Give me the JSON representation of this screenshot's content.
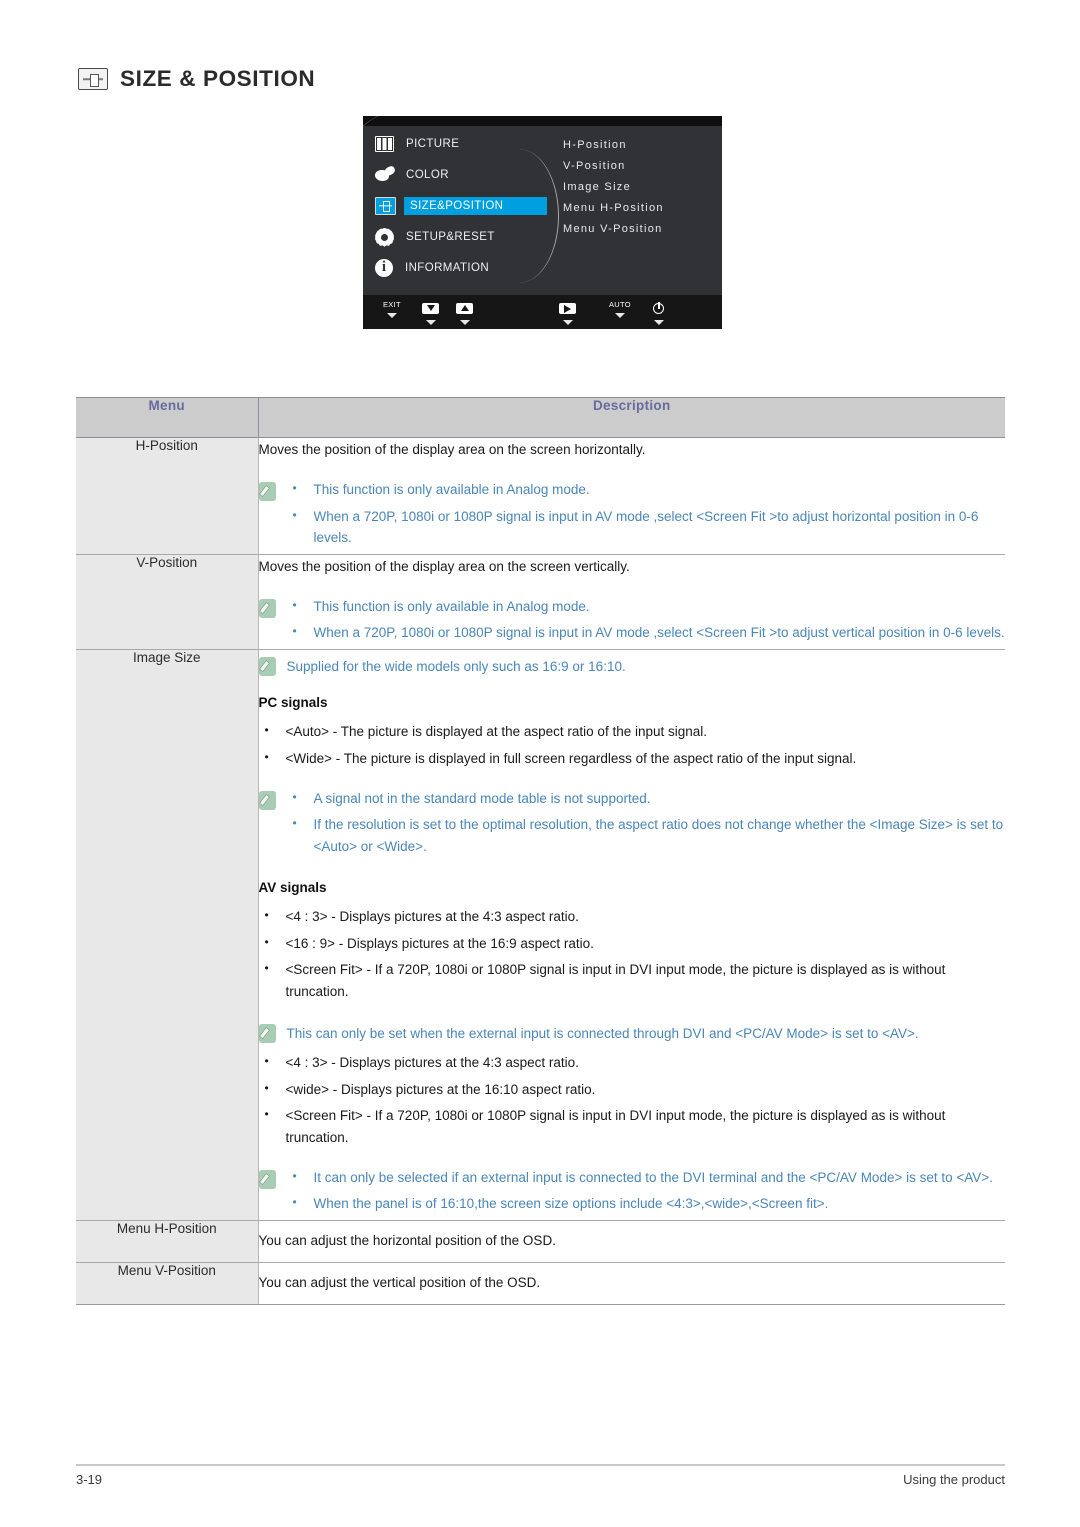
{
  "page": {
    "heading": "SIZE & POSITION",
    "heading_icon": "size-position-icon",
    "footer_page_number": "3-19",
    "footer_section": "Using the product"
  },
  "osd": {
    "menu_items": [
      {
        "label": "PICTURE",
        "icon": "picture-icon",
        "selected": false
      },
      {
        "label": "COLOR",
        "icon": "color-palette-icon",
        "selected": false
      },
      {
        "label": "SIZE&POSITION",
        "icon": "size-position-icon",
        "selected": true
      },
      {
        "label": "SETUP&RESET",
        "icon": "gear-icon",
        "selected": false
      },
      {
        "label": "INFORMATION",
        "icon": "info-icon",
        "selected": false
      }
    ],
    "submenu_items": [
      "H-Position",
      "V-Position",
      "Image Size",
      "Menu H-Position",
      "Menu V-Position"
    ],
    "buttons": [
      {
        "label": "EXIT",
        "icon": "exit-label"
      },
      {
        "label": "",
        "icon": "down-arrow-icon"
      },
      {
        "label": "",
        "icon": "up-arrow-icon"
      },
      {
        "label": "",
        "icon": "enter-icon"
      },
      {
        "label": "AUTO",
        "icon": "auto-label"
      },
      {
        "label": "",
        "icon": "power-icon"
      }
    ],
    "highlight_color": "#00a0e0"
  },
  "table": {
    "headers": {
      "menu": "Menu",
      "description": "Description"
    },
    "header_text_color": "#6a6a9e",
    "note_text_color": "#4a86b8",
    "rows": [
      {
        "menu": "H-Position",
        "intro": "Moves the position of the display area on the screen horizontally.",
        "note_bullets": [
          "This function is only available in Analog mode.",
          "When a 720P, 1080i or 1080P signal is input in AV mode ,select <Screen Fit  >to adjust horizontal position in 0-6 levels."
        ]
      },
      {
        "menu": "V-Position",
        "intro": "Moves the position of the display area on the screen vertically.",
        "note_bullets": [
          "This function is only available in Analog mode.",
          "When a 720P, 1080i or 1080P signal is input in AV mode ,select <Screen Fit  >to adjust vertical position in 0-6 levels."
        ]
      },
      {
        "menu": "Image Size",
        "top_note": "Supplied for the wide models only such as 16:9 or 16:10.",
        "pc_heading": "PC signals",
        "pc_bullets": [
          "<Auto> - The picture is displayed at the aspect ratio of the input signal.",
          "<Wide> - The picture is displayed in full screen regardless of the aspect ratio of the input signal."
        ],
        "pc_note_bullets": [
          "A signal not in the standard mode table is not supported.",
          "If the resolution is set to the optimal resolution, the aspect ratio does not change whether the <Image Size> is set to <Auto> or <Wide>."
        ],
        "av_heading": "AV signals",
        "av_bullets": [
          "<4 : 3> - Displays pictures at the 4:3 aspect ratio.",
          "<16 : 9> - Displays pictures at the 16:9 aspect ratio.",
          "<Screen Fit> - If a 720P, 1080i or 1080P signal is input in DVI input mode, the picture is displayed as is without truncation."
        ],
        "av_note": "This can only be set when the external input is connected through DVI and <PC/AV Mode> is set to <AV>.",
        "wide_bullets": [
          "<4 : 3> - Displays pictures at the 4:3 aspect ratio.",
          "<wide> - Displays pictures at the 16:10 aspect ratio.",
          "<Screen Fit> - If a 720P, 1080i or 1080P signal is input in DVI input mode, the picture is displayed as is without truncation."
        ],
        "wide_note_bullets": [
          "It can only be selected if an external input is connected to the DVI terminal and the <PC/AV Mode> is set to <AV>.",
          "When the panel is of 16:10,the screen size options include <4:3>,<wide>,<Screen fit>."
        ]
      },
      {
        "menu": "Menu H-Position",
        "intro": "You can adjust the horizontal position of the OSD."
      },
      {
        "menu": "Menu V-Position",
        "intro": "You can adjust the vertical position of the OSD."
      }
    ]
  }
}
